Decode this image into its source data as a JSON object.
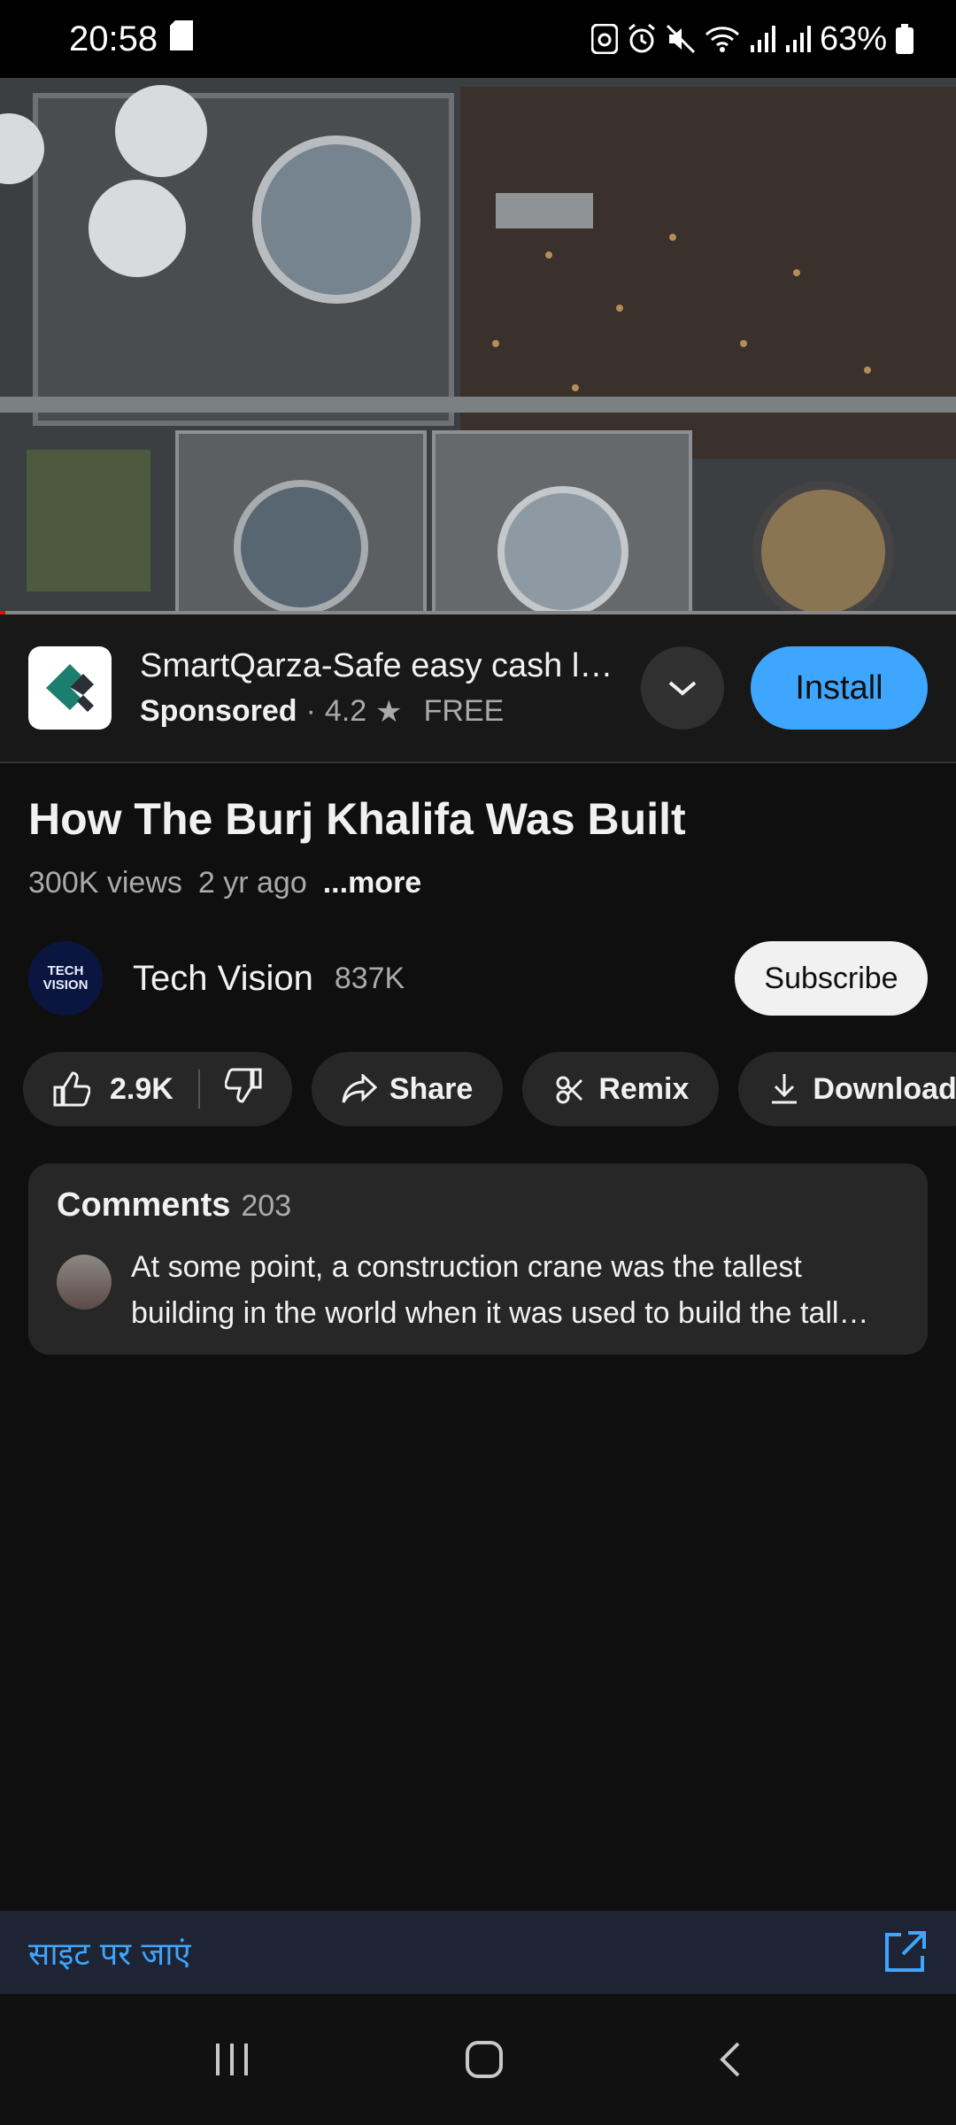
{
  "status_bar": {
    "time": "20:58",
    "battery_percent": "63%",
    "icons": [
      "sd-card-icon",
      "sync-icon",
      "alarm-icon",
      "mute-icon",
      "wifi-icon",
      "signal-icon",
      "signal-icon",
      "battery-icon"
    ]
  },
  "video": {
    "progress_fraction": 0.005
  },
  "ad": {
    "title": "SmartQarza-Safe easy cash loan app",
    "sponsored_label": "Sponsored",
    "separator": "·",
    "rating": "4.2",
    "star": "★",
    "price": "FREE",
    "install_label": "Install"
  },
  "video_info": {
    "title": "How The Burj Khalifa Was Built",
    "views": "300K views",
    "age": "2 yr ago",
    "more_label": "...more"
  },
  "channel": {
    "avatar_line1": "TECH",
    "avatar_line2": "VISION",
    "name": "Tech Vision",
    "subscribers": "837K",
    "subscribe_label": "Subscribe"
  },
  "actions": {
    "like_count": "2.9K",
    "share_label": "Share",
    "remix_label": "Remix",
    "download_label": "Download"
  },
  "comments": {
    "title": "Comments",
    "count": "203",
    "top_comment": "At some point, a construction crane was the tallest building in the world when it was used to build the tall…"
  },
  "site_bar": {
    "link_label": "साइट पर जाएं"
  },
  "colors": {
    "background": "#0f0f0f",
    "accent": "#3ea6ff",
    "pill": "#272727"
  }
}
